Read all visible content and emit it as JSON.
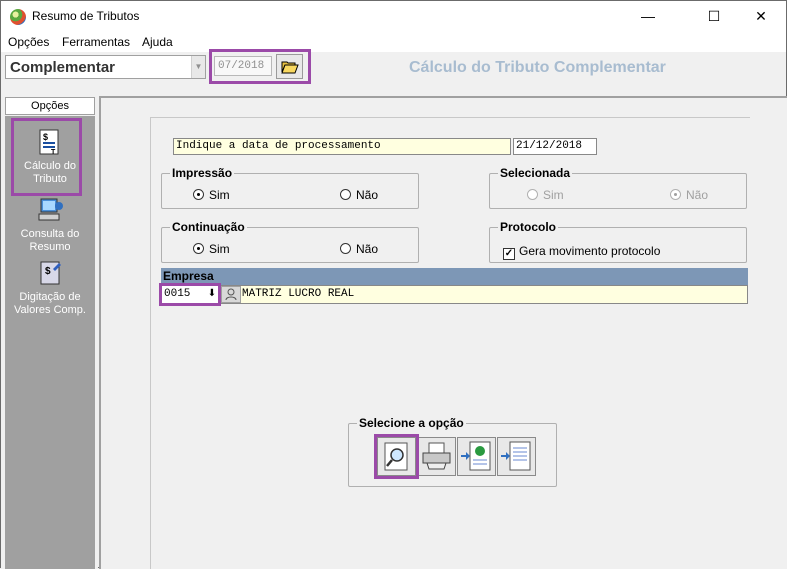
{
  "window": {
    "title": "Resumo de Tributos",
    "minimize_glyph": "—",
    "maximize_glyph": "☐",
    "close_glyph": "✕"
  },
  "menu": {
    "items": [
      "Opções",
      "Ferramentas",
      "Ajuda"
    ]
  },
  "toolbar": {
    "combo_value": "Complementar",
    "date_value": "07/2018",
    "heading": "Cálculo do Tributo Complementar"
  },
  "sidebar": {
    "header": "Opções",
    "items": [
      {
        "label_line1": "Cálculo do",
        "label_line2": "Tributo",
        "icon": "calculator-document-icon"
      },
      {
        "label_line1": "Consulta do",
        "label_line2": "Resumo",
        "icon": "computer-icon"
      },
      {
        "label_line1": "Digitação de",
        "label_line2": "Valores Comp.",
        "icon": "edit-document-icon"
      }
    ]
  },
  "form": {
    "processing_label": "Indique a data de processamento",
    "processing_date": "21/12/2018",
    "impressao": {
      "title": "Impressão",
      "sim": "Sim",
      "nao": "Não",
      "selected": "Sim"
    },
    "selecionada": {
      "title": "Selecionada",
      "sim": "Sim",
      "nao": "Não",
      "selected": "Não",
      "disabled": true
    },
    "continuacao": {
      "title": "Continuação",
      "sim": "Sim",
      "nao": "Não",
      "selected": "Sim"
    },
    "protocolo": {
      "title": "Protocolo",
      "checkbox_label": "Gera movimento protocolo",
      "checked": true
    },
    "empresa": {
      "header": "Empresa",
      "code": "0015",
      "name": "MATRIZ LUCRO REAL"
    },
    "options_group": {
      "title": "Selecione a opção",
      "buttons": [
        "preview-icon",
        "printer-icon",
        "export-web-icon",
        "export-document-icon"
      ]
    }
  },
  "colors": {
    "highlight": "#9b4aa8",
    "heading": "#a8bcd0",
    "empresa_bar": "#7d97b6",
    "sidebar_bg": "#a0a0a0",
    "input_yellow": "#ffffe0"
  }
}
